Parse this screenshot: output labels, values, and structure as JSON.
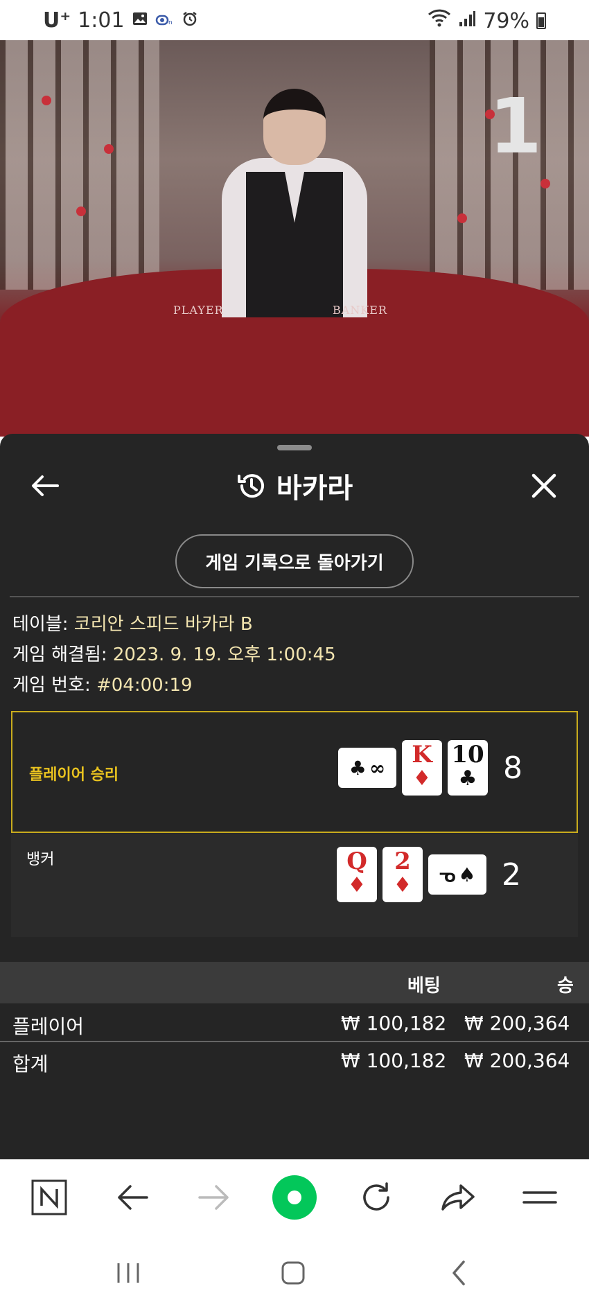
{
  "status_bar": {
    "carrier": "U⁺",
    "time": "1:01",
    "battery": "79%"
  },
  "video": {
    "round_indicator": "1",
    "table_player_label": "PLAYER",
    "table_banker_label": "BANKER"
  },
  "panel": {
    "title": "바카라",
    "back_to_history_label": "게임 기록으로 돌아가기",
    "table_label": "테이블:",
    "table_value": "코리안 스피드 바카라 B",
    "resolved_label": "게임 해결됨:",
    "resolved_value": "2023. 9. 19. 오후 1:00:45",
    "game_no_label": "게임 번호:",
    "game_no_value": "#04:00:19"
  },
  "result": {
    "player": {
      "label": "플레이어 승리",
      "score": "8",
      "cards": [
        {
          "rank": "∞",
          "suit": "♣",
          "color": "black",
          "rotated": true
        },
        {
          "rank": "K",
          "suit": "♦",
          "color": "red",
          "rotated": false
        },
        {
          "rank": "10",
          "suit": "♣",
          "color": "black",
          "rotated": false
        }
      ]
    },
    "banker": {
      "label": "뱅커",
      "score": "2",
      "cards": [
        {
          "rank": "Q",
          "suit": "♦",
          "color": "red",
          "rotated": false
        },
        {
          "rank": "2",
          "suit": "♦",
          "color": "red",
          "rotated": false
        },
        {
          "rank": "ᓀ",
          "suit": "♠",
          "color": "black",
          "rotated": true
        }
      ]
    }
  },
  "bets": {
    "header_bet": "베팅",
    "header_win": "승",
    "rows": [
      {
        "name": "플레이어",
        "bet": "₩ 100,182",
        "win": "₩ 200,364"
      },
      {
        "name": "합계",
        "bet": "₩ 100,182",
        "win": "₩ 200,364"
      }
    ]
  },
  "colors": {
    "panel_bg": "#252525",
    "winner_border": "#c9ac1d",
    "winner_text": "#e8c21f",
    "info_value": "#f3e5b0",
    "brand_green": "#03c75a"
  }
}
